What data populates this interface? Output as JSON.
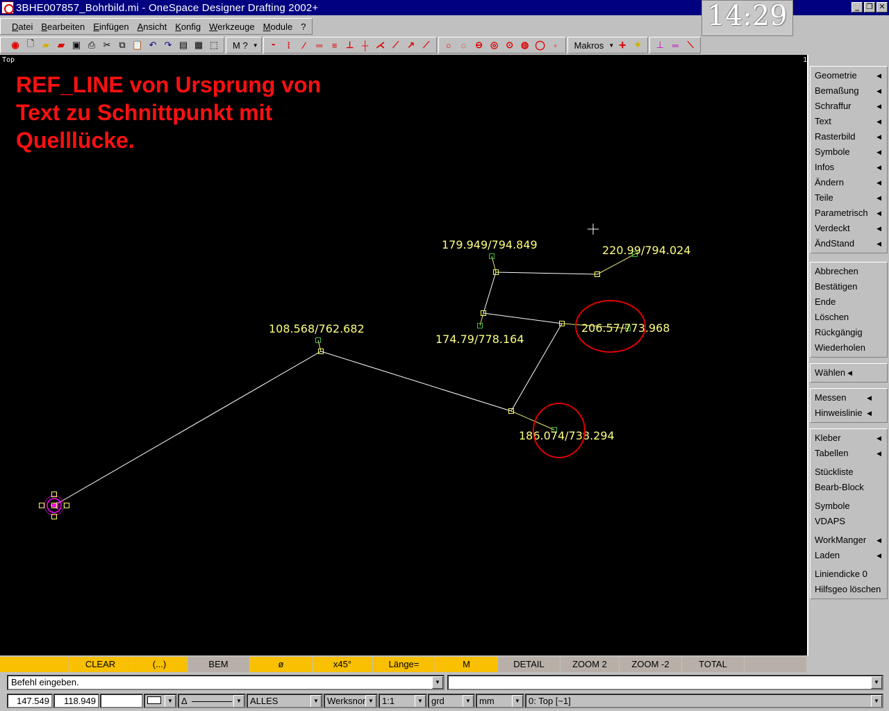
{
  "window": {
    "title": "3BHE007857_Bohrbild.mi - OneSpace Designer Drafting 2002+",
    "clock": "14:29",
    "controls": {
      "minimize": "_",
      "restore": "❐",
      "close": "✕"
    }
  },
  "menu": [
    "Datei",
    "Bearbeiten",
    "Einfügen",
    "Ansicht",
    "Konfig",
    "Werkzeuge",
    "Module",
    "?"
  ],
  "toolbar": {
    "file_icons": [
      "new-icon",
      "open-icon",
      "open-red-icon",
      "save-icon",
      "print-icon",
      "cut-icon",
      "copy-icon",
      "paste-icon",
      "undo-icon",
      "redo-icon",
      "list-icon",
      "calculator-icon",
      "select-box-icon"
    ],
    "mode_label": "M ?",
    "makros_label": "Makros"
  },
  "viewport": {
    "label": "Top",
    "corner": "1",
    "annotation_lines": [
      "REF_LINE von Ursprung von",
      "Text zu Schnittpunkt mit",
      "Quelllücke."
    ],
    "colors": {
      "background": "#000000",
      "geometry": "#ffffff",
      "text": "#ffff80",
      "ref_marker": "#40c040",
      "highlight": "#e00000",
      "origin": "#ff00ff"
    },
    "labels": [
      "179.949/794.849",
      "220.99/794.024",
      "174.79/778.164",
      "206.57/773.968",
      "108.568/762.682",
      "186.074/738.294"
    ]
  },
  "sidemenu": {
    "group1": [
      "Geometrie",
      "Bemaßung",
      "Schraffur",
      "Text",
      "Rasterbild",
      "Symbole",
      "Infos",
      "Ändern",
      "Teile",
      "Parametrisch",
      "Verdeckt",
      "ÄndStand"
    ],
    "group2": [
      "Abbrechen",
      "Bestätigen",
      "Ende",
      "Löschen",
      "Rückgängig",
      "Wiederholen"
    ],
    "group3": [
      "Wählen"
    ],
    "group4": [
      "Messen",
      "Hinweislinie"
    ],
    "group5": [
      "Kleber",
      "Tabellen",
      "Stückliste",
      "Bearb-Block",
      "Symbole",
      "VDAPS",
      "WorkManger",
      "Laden",
      "Liniendicke 0",
      "Hilfsgeo löschen"
    ]
  },
  "softkeys": [
    "",
    "CLEAR",
    "(...)",
    "BEM",
    "ø",
    "x45°",
    "Länge=",
    "M",
    "DETAIL",
    "ZOOM 2",
    "ZOOM -2",
    "TOTAL"
  ],
  "command": {
    "prompt": "Befehl eingeben."
  },
  "status": {
    "x": "147.549",
    "y": "118.949",
    "line_type": "Δ",
    "filter": "ALLES",
    "standard": "Werksnor",
    "scale": "1:1",
    "angle_unit": "grd",
    "length_unit": "mm",
    "view": "0: Top [~1]"
  }
}
